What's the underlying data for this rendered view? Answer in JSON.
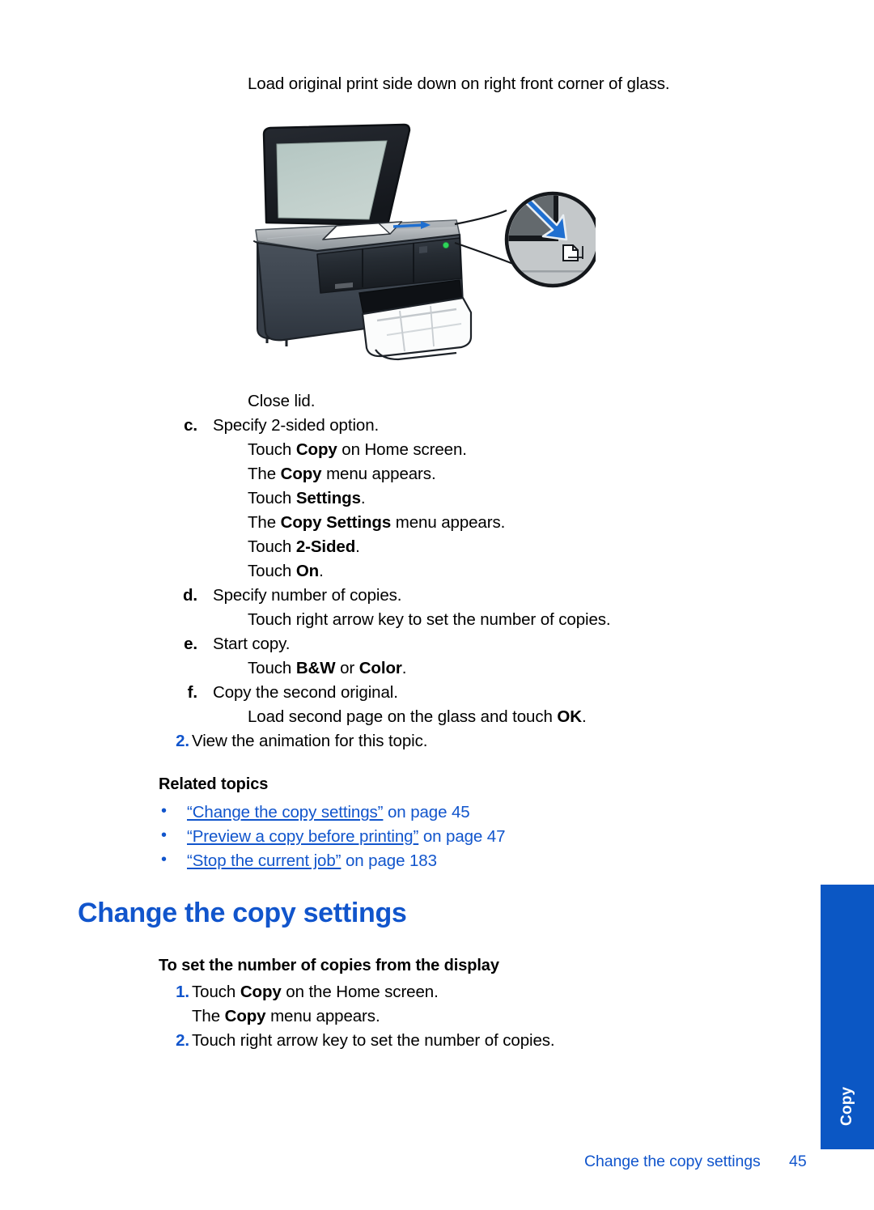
{
  "page": {
    "intro_line": "Load original print side down on right front corner of glass.",
    "page_number": "45",
    "footer_title": "Change the copy settings",
    "side_tab_label": "Copy",
    "accent_blue": "#1155CC",
    "tab_blue": "#0B57C4"
  },
  "illustration": {
    "name": "all-in-one-printer-load-original",
    "alt": "Printer with lid open, original page face down on right front corner of glass, magnified callout of corner with blue arrow and document icon",
    "callout_arrow_color": "#1F6FD0",
    "glass_color": "#B9C9C4",
    "lid_color": "#1F2228",
    "body_color": "#3C444E"
  },
  "steps": [
    {
      "marker": "",
      "marker_style": "none",
      "indent": "sub",
      "parts": [
        {
          "t": "Close lid.",
          "bold": false
        }
      ]
    },
    {
      "marker": "c.",
      "marker_style": "alpha",
      "indent": "alpha",
      "parts": [
        {
          "t": "Specify 2-sided option.",
          "bold": false
        }
      ]
    },
    {
      "marker": "",
      "marker_style": "none",
      "indent": "sub",
      "parts": [
        {
          "t": "Touch ",
          "bold": false
        },
        {
          "t": "Copy",
          "bold": true
        },
        {
          "t": " on Home screen.",
          "bold": false
        }
      ]
    },
    {
      "marker": "",
      "marker_style": "none",
      "indent": "sub",
      "parts": [
        {
          "t": "The ",
          "bold": false
        },
        {
          "t": "Copy",
          "bold": true
        },
        {
          "t": " menu appears.",
          "bold": false
        }
      ]
    },
    {
      "marker": "",
      "marker_style": "none",
      "indent": "sub",
      "parts": [
        {
          "t": "Touch ",
          "bold": false
        },
        {
          "t": "Settings",
          "bold": true
        },
        {
          "t": ".",
          "bold": false
        }
      ]
    },
    {
      "marker": "",
      "marker_style": "none",
      "indent": "sub",
      "parts": [
        {
          "t": "The ",
          "bold": false
        },
        {
          "t": "Copy Settings",
          "bold": true
        },
        {
          "t": " menu appears.",
          "bold": false
        }
      ]
    },
    {
      "marker": "",
      "marker_style": "none",
      "indent": "sub",
      "parts": [
        {
          "t": "Touch ",
          "bold": false
        },
        {
          "t": "2-Sided",
          "bold": true
        },
        {
          "t": ".",
          "bold": false
        }
      ]
    },
    {
      "marker": "",
      "marker_style": "none",
      "indent": "sub",
      "parts": [
        {
          "t": "Touch ",
          "bold": false
        },
        {
          "t": "On",
          "bold": true
        },
        {
          "t": ".",
          "bold": false
        }
      ]
    },
    {
      "marker": "d.",
      "marker_style": "alpha",
      "indent": "alpha",
      "parts": [
        {
          "t": "Specify number of copies.",
          "bold": false
        }
      ]
    },
    {
      "marker": "",
      "marker_style": "none",
      "indent": "sub",
      "parts": [
        {
          "t": "Touch right arrow key to set the number of copies.",
          "bold": false
        }
      ]
    },
    {
      "marker": "e.",
      "marker_style": "alpha",
      "indent": "alpha",
      "parts": [
        {
          "t": "Start copy.",
          "bold": false
        }
      ]
    },
    {
      "marker": "",
      "marker_style": "none",
      "indent": "sub",
      "parts": [
        {
          "t": "Touch ",
          "bold": false
        },
        {
          "t": "B&W",
          "bold": true
        },
        {
          "t": " or ",
          "bold": false
        },
        {
          "t": "Color",
          "bold": true
        },
        {
          "t": ".",
          "bold": false
        }
      ]
    },
    {
      "marker": "f.",
      "marker_style": "alpha",
      "indent": "alpha",
      "parts": [
        {
          "t": "Copy the second original.",
          "bold": false
        }
      ]
    },
    {
      "marker": "",
      "marker_style": "none",
      "indent": "sub",
      "parts": [
        {
          "t": "Load second page on the glass and touch ",
          "bold": false
        },
        {
          "t": "OK",
          "bold": true
        },
        {
          "t": ".",
          "bold": false
        }
      ]
    },
    {
      "marker": "2.",
      "marker_style": "num",
      "indent": "num",
      "parts": [
        {
          "t": "View the animation for this topic.",
          "bold": false
        }
      ]
    }
  ],
  "related": {
    "title": "Related topics",
    "bullet_glyph": "•",
    "items": [
      {
        "link": "“Change the copy settings”",
        "suffix": " on page 45"
      },
      {
        "link": "“Preview a copy before printing”",
        "suffix": " on page 47"
      },
      {
        "link": "“Stop the current job”",
        "suffix": " on page 183"
      }
    ]
  },
  "section": {
    "heading": "Change the copy settings",
    "procedure_title": "To set the number of copies from the display",
    "procedure_steps": [
      {
        "marker": "1.",
        "marker_style": "num",
        "indent": "num",
        "parts": [
          {
            "t": "Touch ",
            "bold": false
          },
          {
            "t": "Copy",
            "bold": true
          },
          {
            "t": " on the Home screen.",
            "bold": false
          }
        ]
      },
      {
        "marker": "",
        "marker_style": "none",
        "indent": "num",
        "parts": [
          {
            "t": "The ",
            "bold": false
          },
          {
            "t": "Copy",
            "bold": true
          },
          {
            "t": " menu appears.",
            "bold": false
          }
        ]
      },
      {
        "marker": "2.",
        "marker_style": "num",
        "indent": "num",
        "parts": [
          {
            "t": "Touch right arrow key to set the number of copies.",
            "bold": false
          }
        ]
      }
    ]
  }
}
